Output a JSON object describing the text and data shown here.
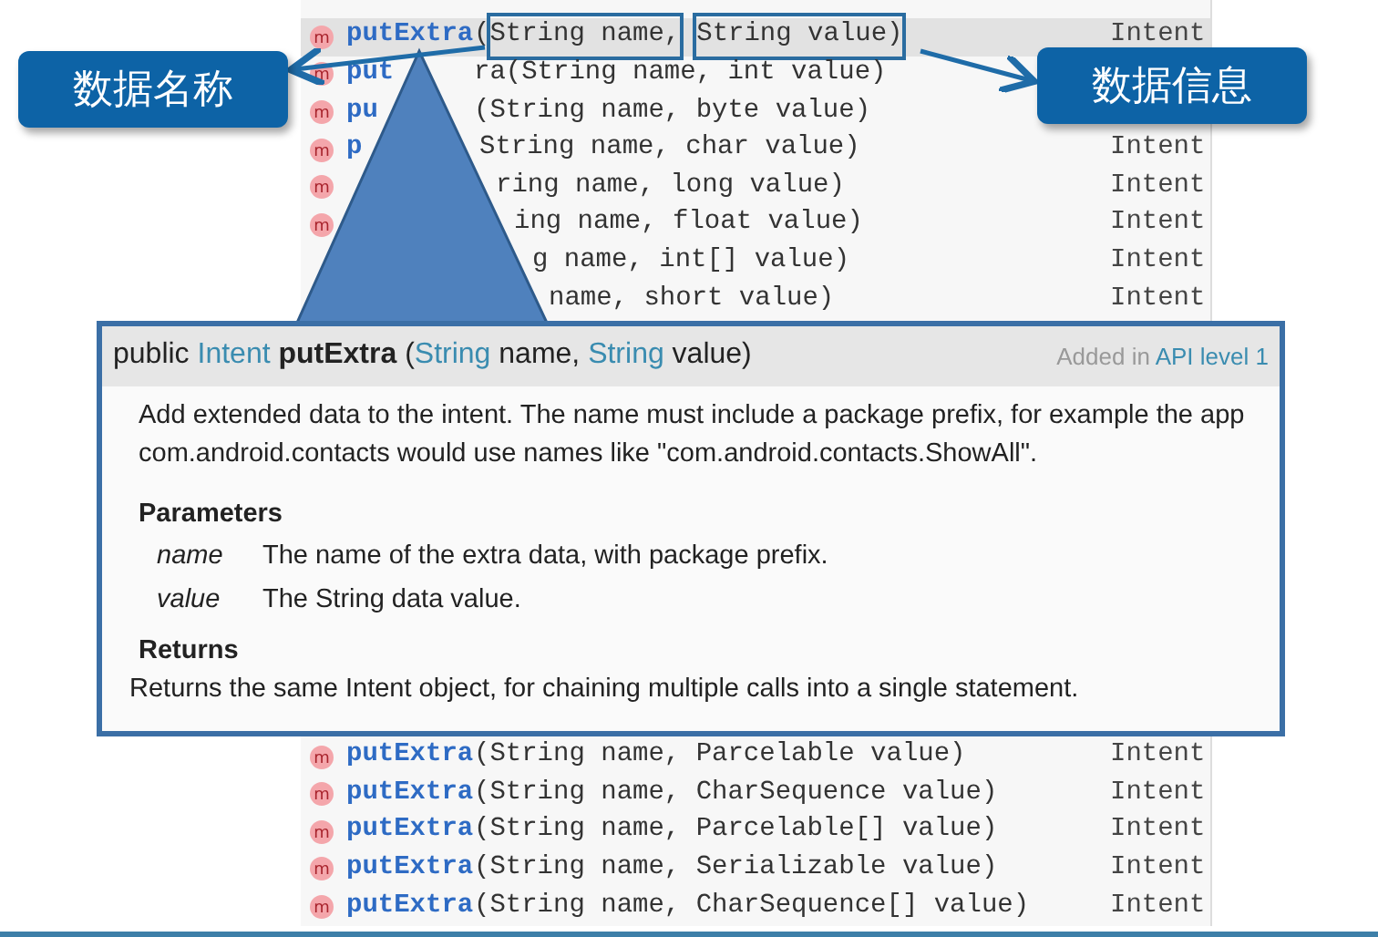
{
  "completion_list": {
    "rows_above": [
      {
        "icon": "m",
        "selected": true,
        "name": "putExtra",
        "parts": [
          {
            "text": "(",
            "boxed": false
          },
          {
            "text": "String name,",
            "boxed": true
          },
          {
            "text": "String value)",
            "boxed": true
          }
        ],
        "type": "Intent"
      },
      {
        "icon": "m",
        "selected": false,
        "name": "put",
        "parts": [
          {
            "text": "ra(String name, int value)",
            "boxed": false
          }
        ]
      },
      {
        "icon": "m",
        "selected": false,
        "name": "pu",
        "parts": [
          {
            "text": "(String name, byte value)",
            "boxed": false
          }
        ]
      },
      {
        "icon": "m",
        "selected": false,
        "name": "p",
        "parts": [
          {
            "text": "String name, char value)",
            "boxed": false
          }
        ],
        "type": "Intent"
      },
      {
        "icon": "m",
        "selected": false,
        "parts": [
          {
            "text": "ring name, long value)",
            "boxed": false
          }
        ],
        "type": "Intent"
      },
      {
        "icon": "m",
        "selected": false,
        "parts": [
          {
            "text": "ing name, float value)",
            "boxed": false
          }
        ],
        "type": "Intent"
      },
      {
        "selected": false,
        "parts": [
          {
            "text": "g name, int[] value)",
            "boxed": false
          }
        ],
        "type": "Intent"
      },
      {
        "selected": false,
        "parts": [
          {
            "text": "name, short value)",
            "boxed": false
          }
        ],
        "type": "Intent"
      }
    ],
    "rows_below": [
      {
        "icon": "m",
        "selected": false,
        "name": "putExtra",
        "parts": [
          {
            "text": "(String name, Parcelable value)",
            "boxed": false
          }
        ],
        "type": "Intent"
      },
      {
        "icon": "m",
        "selected": false,
        "name": "putExtra",
        "parts": [
          {
            "text": "(String name, CharSequence value)",
            "boxed": false
          }
        ],
        "type": "Intent"
      },
      {
        "icon": "m",
        "selected": false,
        "name": "putExtra",
        "parts": [
          {
            "text": "(String name, Parcelable[] value)",
            "boxed": false
          }
        ],
        "type": "Intent"
      },
      {
        "icon": "m",
        "selected": false,
        "name": "putExtra",
        "parts": [
          {
            "text": "(String name, Serializable value)",
            "boxed": false
          }
        ],
        "type": "Intent"
      },
      {
        "icon": "m",
        "selected": false,
        "name": "putExtra",
        "parts": [
          {
            "text": "(String name, CharSequence[] value)",
            "boxed": false
          }
        ],
        "type": "Intent"
      }
    ]
  },
  "doc_popup": {
    "signature": [
      {
        "text": "public ",
        "kind": "plain"
      },
      {
        "text": "Intent",
        "kind": "type"
      },
      {
        "text": " putExtra",
        "kind": "method"
      },
      {
        "text": " (",
        "kind": "plain"
      },
      {
        "text": "String",
        "kind": "type"
      },
      {
        "text": " name, ",
        "kind": "plain"
      },
      {
        "text": "String",
        "kind": "type"
      },
      {
        "text": " value)",
        "kind": "plain"
      }
    ],
    "added_label": "Added in",
    "added_link": "API level 1",
    "description": "Add extended data to the intent. The name must include a package prefix, for example the app com.android.contacts would use names like \"com.android.contacts.ShowAll\".",
    "parameters_heading": "Parameters",
    "parameters": [
      {
        "name": "name",
        "description": "The name of the extra data, with package prefix."
      },
      {
        "name": "value",
        "description": "The String data value."
      }
    ],
    "returns_heading": "Returns",
    "returns": "Returns the same Intent object, for chaining multiple calls into a single statement."
  },
  "callouts": [
    "数据名称",
    "数据信息"
  ]
}
